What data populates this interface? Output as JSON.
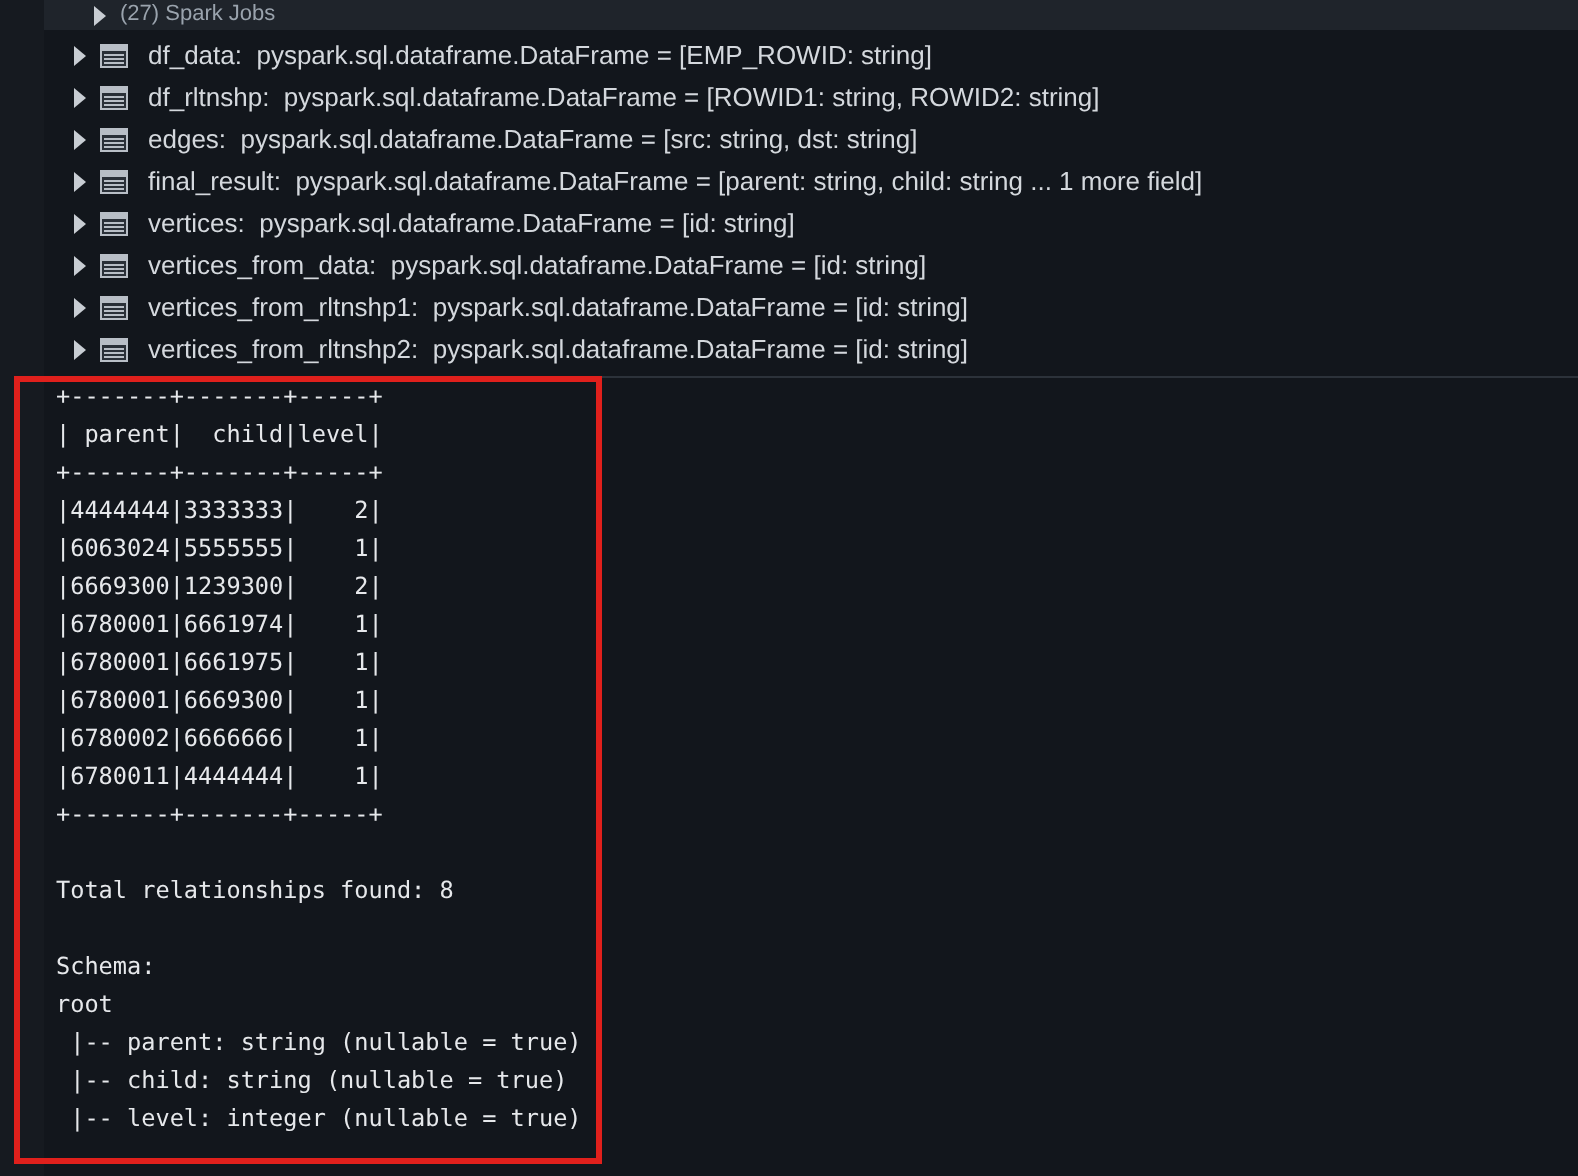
{
  "spark_jobs": {
    "label": "(27) Spark Jobs",
    "expanded": false
  },
  "variables": [
    {
      "name": "df_data:",
      "type": "pyspark.sql.dataframe.DataFrame = [EMP_ROWID: string]",
      "expanded": false
    },
    {
      "name": "df_rltnshp:",
      "type": "pyspark.sql.dataframe.DataFrame = [ROWID1: string, ROWID2: string]",
      "expanded": false
    },
    {
      "name": "edges:",
      "type": "pyspark.sql.dataframe.DataFrame = [src: string, dst: string]",
      "expanded": false
    },
    {
      "name": "final_result:",
      "type": "pyspark.sql.dataframe.DataFrame = [parent: string, child: string ... 1 more field]",
      "expanded": false
    },
    {
      "name": "vertices:",
      "type": "pyspark.sql.dataframe.DataFrame = [id: string]",
      "expanded": false
    },
    {
      "name": "vertices_from_data:",
      "type": "pyspark.sql.dataframe.DataFrame = [id: string]",
      "expanded": false
    },
    {
      "name": "vertices_from_rltnshp1:",
      "type": "pyspark.sql.dataframe.DataFrame = [id: string]",
      "expanded": false
    },
    {
      "name": "vertices_from_rltnshp2:",
      "type": "pyspark.sql.dataframe.DataFrame = [id: string]",
      "expanded": false
    }
  ],
  "output": {
    "table": [
      "+-------+-------+-----+",
      "| parent|  child|level|",
      "+-------+-------+-----+",
      "|4444444|3333333|    2|",
      "|6063024|5555555|    1|",
      "|6669300|1239300|    2|",
      "|6780001|6661974|    1|",
      "|6780001|6661975|    1|",
      "|6780001|6669300|    1|",
      "|6780002|6666666|    1|",
      "|6780011|4444444|    1|",
      "+-------+-------+-----+"
    ],
    "summary": "Total relationships found: 8",
    "schema": [
      "Schema:",
      "root",
      " |-- parent: string (nullable = true)",
      " |-- child: string (nullable = true)",
      " |-- level: integer (nullable = true)"
    ]
  }
}
